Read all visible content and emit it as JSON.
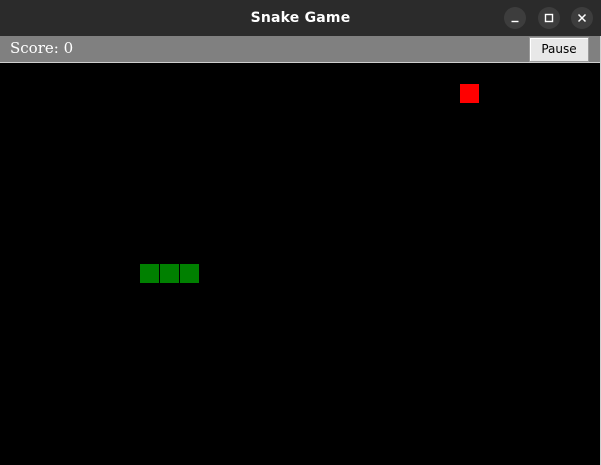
{
  "window": {
    "title": "Snake Game"
  },
  "toolbar": {
    "score_text": "Score: 0",
    "pause_label": "Pause"
  },
  "game": {
    "score": 0,
    "snake_color": "#008000",
    "food_color": "#ff0000",
    "background_color": "#000000"
  }
}
